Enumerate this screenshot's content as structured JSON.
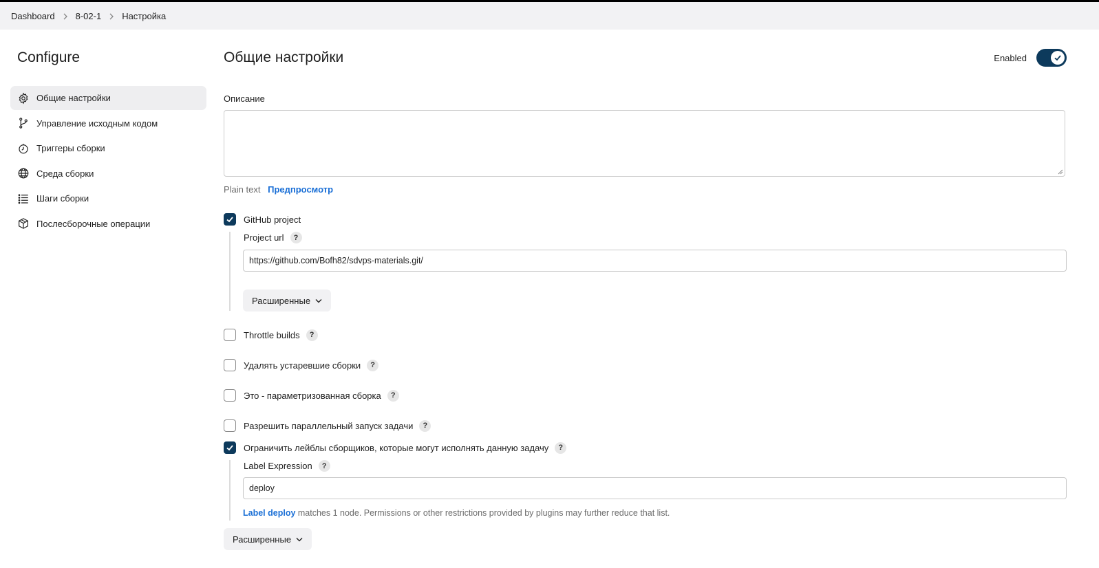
{
  "breadcrumb": {
    "items": [
      "Dashboard",
      "8-02-1",
      "Настройка"
    ]
  },
  "sidebar": {
    "title": "Configure",
    "items": [
      {
        "label": "Общие настройки",
        "icon": "gear-icon",
        "active": true
      },
      {
        "label": "Управление исходным кодом",
        "icon": "branch-icon"
      },
      {
        "label": "Триггеры сборки",
        "icon": "timer-icon"
      },
      {
        "label": "Среда сборки",
        "icon": "globe-icon"
      },
      {
        "label": "Шаги сборки",
        "icon": "list-icon"
      },
      {
        "label": "Послесборочные операции",
        "icon": "package-icon"
      }
    ]
  },
  "main": {
    "title": "Общие настройки",
    "enabled_label": "Enabled",
    "enabled": true,
    "description": {
      "label": "Описание",
      "value": "",
      "plain_text": "Plain text",
      "preview_link": "Предпросмотр"
    },
    "github_project": {
      "label": "GitHub project",
      "checked": true,
      "url_label": "Project url",
      "help": "?",
      "url_value": "https://github.com/Bofh82/sdvps-materials.git/",
      "advanced_label": "Расширенные"
    },
    "options": [
      {
        "label": "Throttle builds",
        "checked": false,
        "help": "?"
      },
      {
        "label": "Удалять устаревшие сборки",
        "checked": false,
        "help": "?"
      },
      {
        "label": "Это - параметризованная сборка",
        "checked": false,
        "help": "?"
      },
      {
        "label": "Разрешить параллельный запуск задачи",
        "checked": false,
        "help": "?"
      }
    ],
    "restrict_labels": {
      "label": "Ограничить лейблы сборщиков, которые могут исполнять данную задачу",
      "checked": true,
      "help": "?",
      "expr_label": "Label Expression",
      "expr_value": "deploy",
      "note_link": "Label deploy",
      "note_text": " matches 1 node. Permissions or other restrictions provided by plugins may further reduce that list."
    },
    "advanced_label_2": "Расширенные"
  },
  "colors": {
    "accent": "#0d3a5c",
    "link": "#1a6fd6",
    "breadcrumb_bg": "#f2f2f4"
  }
}
